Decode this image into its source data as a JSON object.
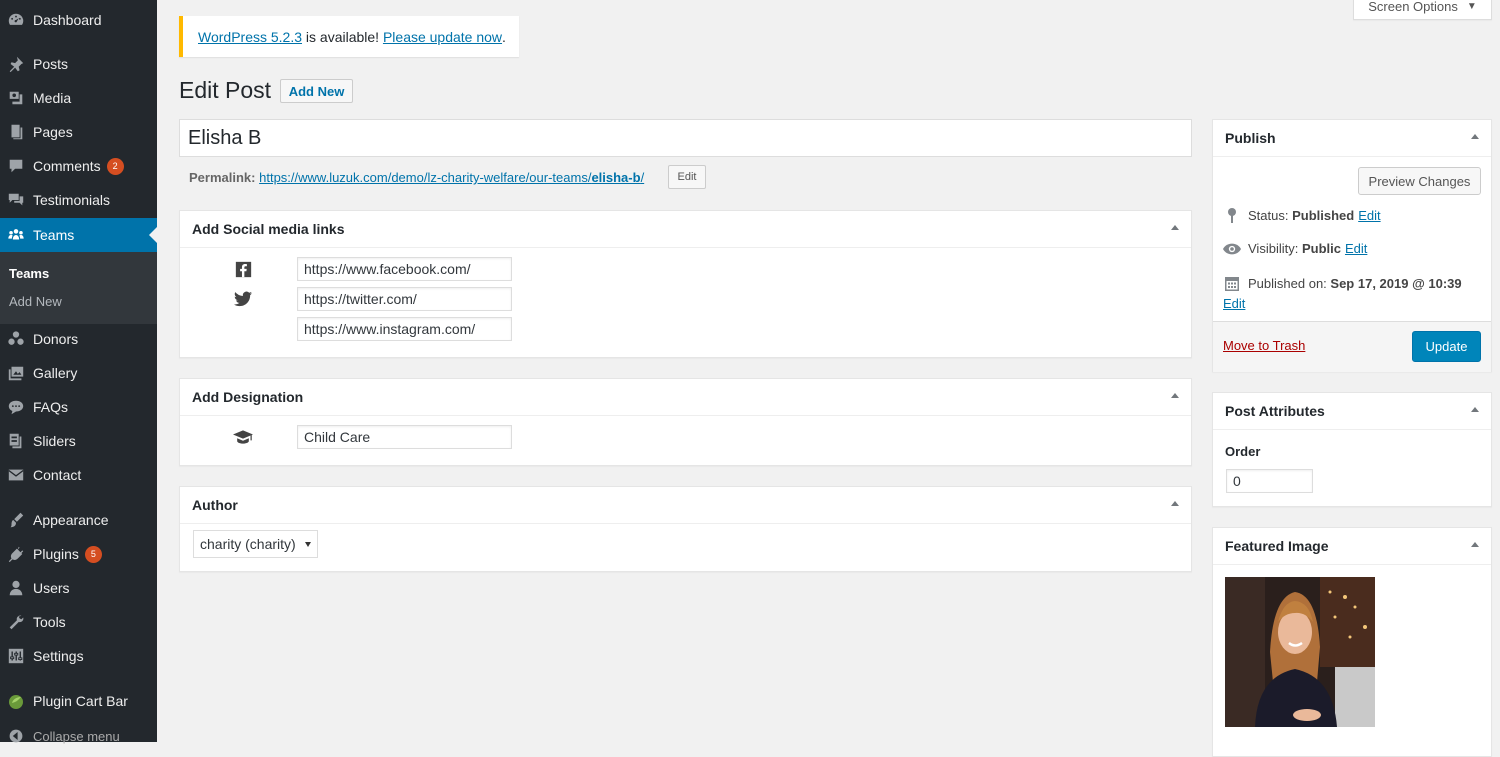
{
  "sidebar": {
    "dashboard": "Dashboard",
    "posts": "Posts",
    "media": "Media",
    "pages": "Pages",
    "comments": "Comments",
    "comments_badge": "2",
    "testimonials": "Testimonials",
    "teams": "Teams",
    "submenu_teams": "Teams",
    "submenu_add_new": "Add New",
    "donors": "Donors",
    "gallery": "Gallery",
    "faqs": "FAQs",
    "sliders": "Sliders",
    "contact": "Contact",
    "appearance": "Appearance",
    "plugins": "Plugins",
    "plugins_badge": "5",
    "users": "Users",
    "tools": "Tools",
    "settings": "Settings",
    "plugin_cart_bar": "Plugin Cart Bar",
    "collapse": "Collapse menu"
  },
  "screen_options": "Screen Options",
  "notice": {
    "version_link": "WordPress 5.2.3",
    "middle": " is available! ",
    "update_link": "Please update now",
    "end": "."
  },
  "header": {
    "title": "Edit Post",
    "add_new": "Add New"
  },
  "post": {
    "title": "Elisha B",
    "permalink_label": "Permalink:",
    "permalink_base": "https://www.luzuk.com/demo/lz-charity-welfare/our-teams/",
    "permalink_slug": "elisha-b",
    "permalink_end": "/",
    "permalink_edit": "Edit"
  },
  "social_box": {
    "title": "Add Social media links",
    "facebook": "https://www.facebook.com/",
    "twitter": "https://twitter.com/",
    "instagram": "https://www.instagram.com/"
  },
  "designation_box": {
    "title": "Add Designation",
    "value": "Child Care"
  },
  "author_box": {
    "title": "Author",
    "selected": "charity (charity)"
  },
  "publish": {
    "title": "Publish",
    "preview": "Preview Changes",
    "status_label": "Status: ",
    "status_value": "Published",
    "visibility_label": "Visibility: ",
    "visibility_value": "Public",
    "published_label": "Published on: ",
    "published_value": "Sep 17, 2019 @ 10:39",
    "edit": "Edit",
    "trash": "Move to Trash",
    "update": "Update"
  },
  "attributes": {
    "title": "Post Attributes",
    "order_label": "Order",
    "order_value": "0"
  },
  "featured": {
    "title": "Featured Image"
  },
  "colors": {
    "sidebar": "#23282d",
    "accent": "#0073aa",
    "notice": "#ffb900",
    "badge": "#d54e21"
  }
}
